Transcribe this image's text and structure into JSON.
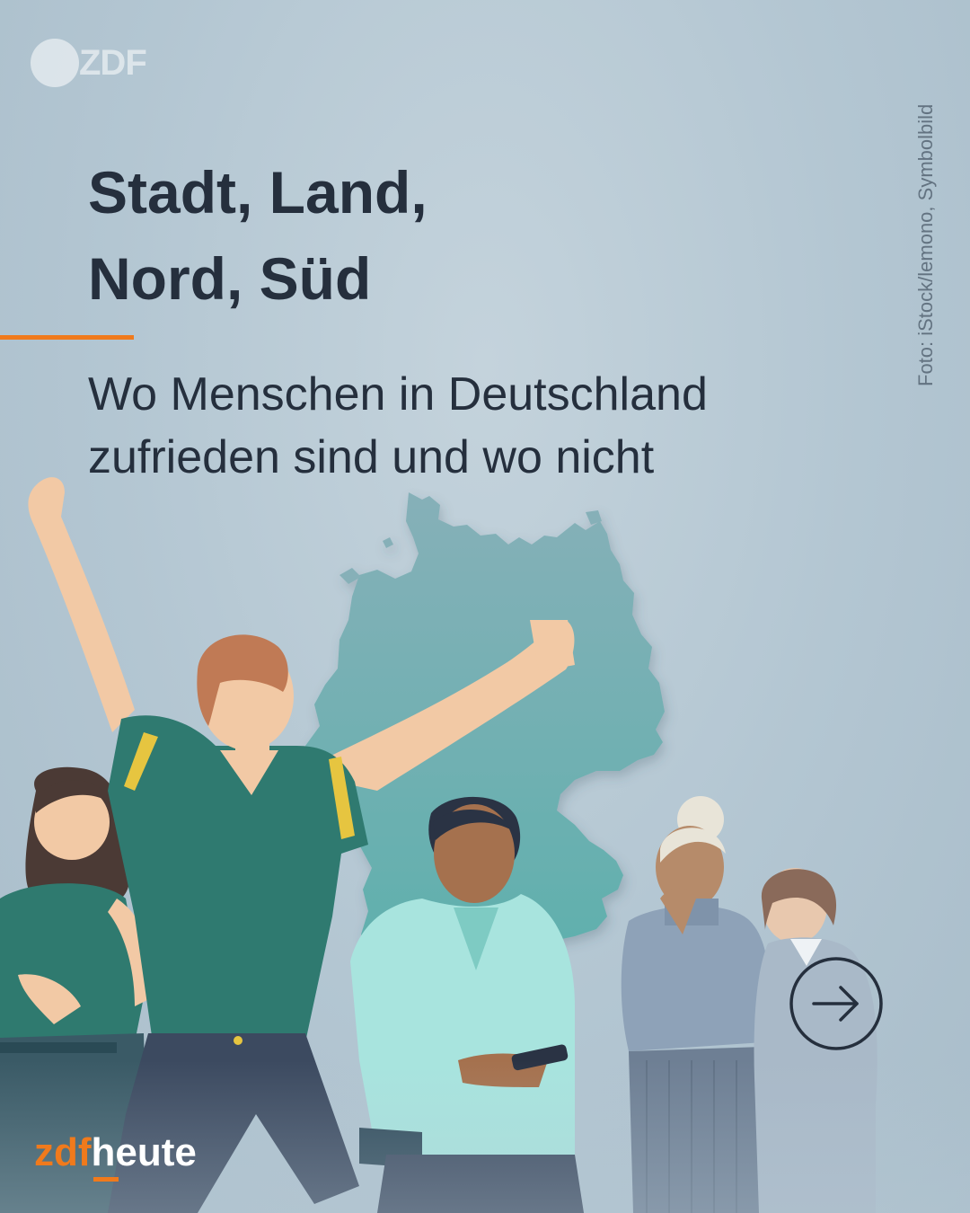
{
  "logo_top": {
    "text": "ZDF"
  },
  "title": {
    "line1": "Stadt, Land,",
    "line2": "Nord, Süd"
  },
  "subtitle": {
    "line1": "Wo Menschen in Deutschland",
    "line2": "zufrieden sind und wo nicht"
  },
  "credit": "Foto: iStock/lemono, Symbolbild",
  "brand": {
    "zdf": "zdf",
    "heute": "heute"
  },
  "next_button": {
    "icon": "arrow-right-circle-icon"
  },
  "colors": {
    "background": "#b8cad5",
    "text": "#252f3d",
    "accent": "#f07a1c",
    "map": "#72a7ad",
    "credit": "#637381"
  }
}
